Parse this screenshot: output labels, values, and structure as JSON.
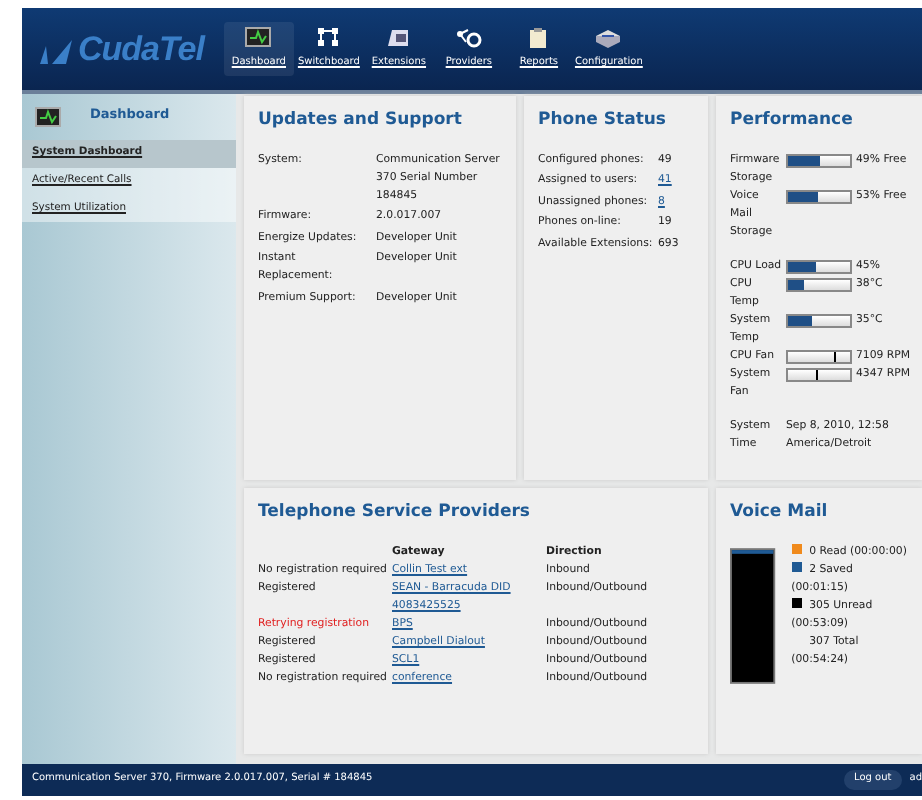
{
  "header": {
    "logo": "CudaTel",
    "nav": [
      {
        "label": "Dashboard",
        "selected": true
      },
      {
        "label": "Switchboard",
        "selected": false
      },
      {
        "label": "Extensions",
        "selected": false
      },
      {
        "label": "Providers",
        "selected": false
      },
      {
        "label": "Reports",
        "selected": false
      },
      {
        "label": "Configuration",
        "selected": false
      }
    ]
  },
  "sidebar": {
    "title": "Dashboard",
    "items": [
      {
        "label": "System Dashboard",
        "selected": true
      },
      {
        "label": "Active/Recent Calls",
        "selected": false
      },
      {
        "label": "System Utilization",
        "selected": false
      }
    ]
  },
  "updates": {
    "title": "Updates and Support",
    "rows": [
      {
        "label": "System:",
        "value": "Communication Server 370 Serial Number 184845"
      },
      {
        "label": "Firmware:",
        "value": "2.0.017.007"
      },
      {
        "label": "Energize Updates:",
        "value": "Developer Unit"
      },
      {
        "label": "Instant Replacement:",
        "value": "Developer Unit"
      },
      {
        "label": "Premium Support:",
        "value": "Developer Unit"
      }
    ]
  },
  "phone_status": {
    "title": "Phone Status",
    "rows": [
      {
        "label": "Configured phones:",
        "value": "49",
        "link": false
      },
      {
        "label": "Assigned to users:",
        "value": "41",
        "link": true
      },
      {
        "label": "Unassigned phones:",
        "value": "8",
        "link": true
      },
      {
        "label": "Phones on-line:",
        "value": "19",
        "link": false
      },
      {
        "label": "Available Extensions:",
        "value": "693",
        "link": false
      }
    ]
  },
  "performance": {
    "title": "Performance",
    "rows": [
      {
        "kind": "bar",
        "label": "Firmware Storage",
        "level": 0.51,
        "reading": "49% Free"
      },
      {
        "kind": "bar",
        "label": "Voice Mail Storage",
        "level": 0.47,
        "reading": "53% Free"
      },
      {
        "kind": "spacer"
      },
      {
        "kind": "bar",
        "label": "CPU Load",
        "level": 0.45,
        "reading": "45%"
      },
      {
        "kind": "bar",
        "label": "CPU Temp",
        "level": 0.25,
        "reading": "38°C"
      },
      {
        "kind": "bar",
        "label": "System Temp",
        "level": 0.4,
        "reading": "35°C"
      },
      {
        "kind": "marker",
        "label": "CPU Fan",
        "level": 0.73,
        "reading": "7109 RPM"
      },
      {
        "kind": "marker",
        "label": "System Fan",
        "level": 0.45,
        "reading": "4347 RPM"
      },
      {
        "kind": "spacer"
      },
      {
        "kind": "text",
        "label": "System Time",
        "reading": "Sep 8, 2010, 12:58 America/Detroit"
      }
    ]
  },
  "providers": {
    "title": "Telephone Service Providers",
    "columns": [
      "Gateway",
      "Direction"
    ],
    "rows": [
      {
        "status": "No registration required",
        "gateway": "Collin Test ext",
        "direction": "Inbound",
        "alert": false
      },
      {
        "status": "Registered",
        "gateway": "SEAN - Barracuda DID 4083425525",
        "direction": "Inbound/Outbound",
        "alert": false
      },
      {
        "status": "Retrying registration",
        "gateway": "BPS",
        "direction": "Inbound/Outbound",
        "alert": true
      },
      {
        "status": "Registered",
        "gateway": "Campbell Dialout",
        "direction": "Inbound/Outbound",
        "alert": false
      },
      {
        "status": "Registered",
        "gateway": "SCL1",
        "direction": "Inbound/Outbound",
        "alert": false
      },
      {
        "status": "No registration required",
        "gateway": "conference",
        "direction": "Inbound/Outbound",
        "alert": false
      }
    ]
  },
  "voice_mail": {
    "title": "Voice Mail",
    "legend": [
      {
        "label": "0 Read (00:00:00)",
        "color": "#f08a1c"
      },
      {
        "label": "2 Saved (00:01:15)",
        "color": "#1f5a94"
      },
      {
        "label": "305 Unread (00:53:09)",
        "color": "#000000"
      }
    ],
    "total": "307 Total (00:54:24)"
  },
  "footer": {
    "text": "Communication Server 370, Firmware 2.0.017.007, Serial # 184845",
    "logout": "Log out",
    "user": "ad"
  }
}
